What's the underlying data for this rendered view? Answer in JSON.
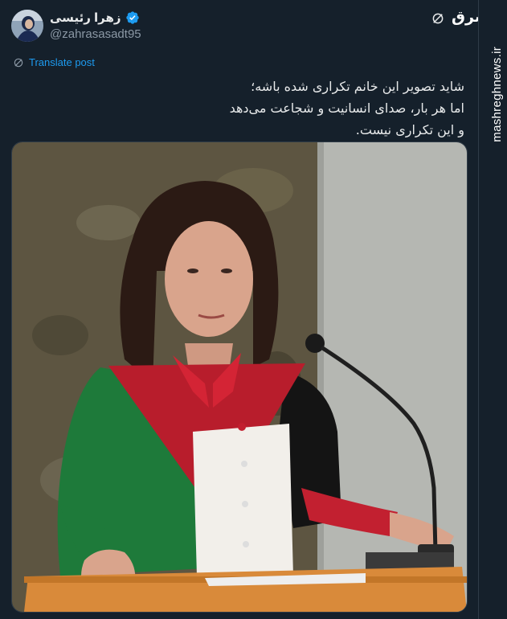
{
  "author": {
    "display_name": "زهرا رئیسی",
    "handle": "@zahrasasadt95",
    "verified": true,
    "avatar_icon": "avatar-portrait"
  },
  "header_icons": {
    "grok": "grok-icon",
    "site_logo_text": "مشرق"
  },
  "translate": {
    "label": "Translate post",
    "icon": "globe-translate-icon"
  },
  "tweet": {
    "lines": [
      "شاید تصویر این خانم تکراری شده باشه؛",
      "اما هر بار، صدای انسانیت و شجاعت می‌دهد",
      "و این تکراری نیست."
    ]
  },
  "media": {
    "type": "photo",
    "icon": "photo-speaker-at-podium"
  },
  "watermark": "mashreghnews.ir",
  "colors": {
    "background": "#15202b",
    "link": "#1d9bf0",
    "verified": "#1d9bf0",
    "text_primary": "#e7e9ea",
    "text_secondary": "#8b98a5"
  }
}
